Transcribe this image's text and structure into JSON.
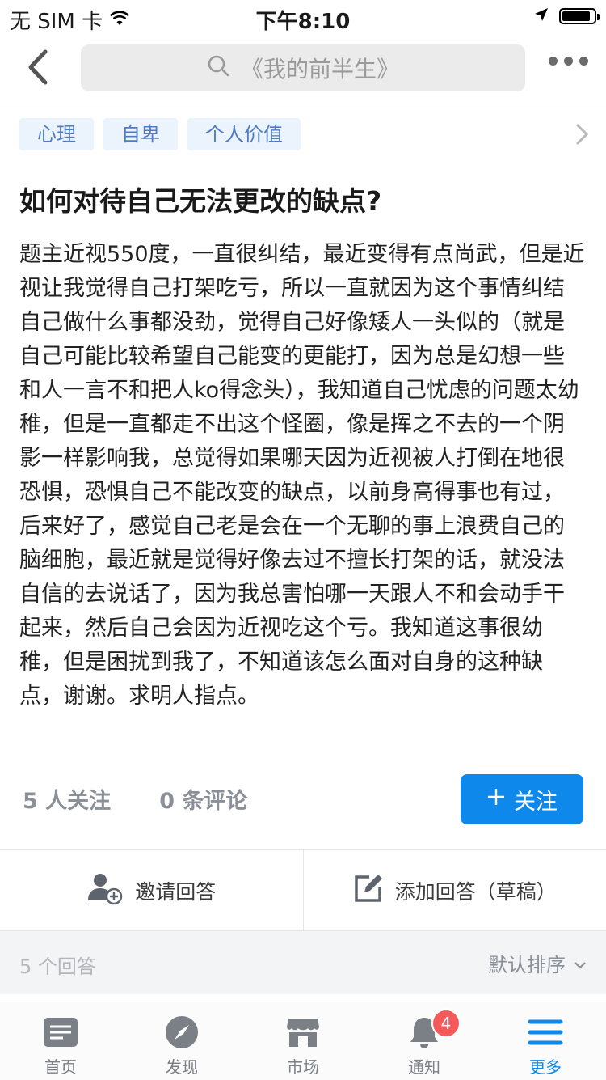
{
  "status_bar": {
    "carrier": "无 SIM 卡",
    "time": "下午8:10"
  },
  "nav": {
    "search_text": "《我的前半生》"
  },
  "tags": [
    "心理",
    "自卑",
    "个人价值"
  ],
  "question": {
    "title": "如何对待自己无法更改的缺点?",
    "body": "题主近视550度，一直很纠结，最近变得有点尚武，但是近视让我觉得自己打架吃亏，所以一直就因为这个事情纠结自己做什么事都没劲，觉得自己好像矮人一头似的（就是自己可能比较希望自己能变的更能打，因为总是幻想一些和人一言不和把人ko得念头），我知道自己忧虑的问题太幼稚，但是一直都走不出这个怪圈，像是挥之不去的一个阴影一样影响我，总觉得如果哪天因为近视被人打倒在地很恐惧，恐惧自己不能改变的缺点，以前身高得事也有过，后来好了，感觉自己老是会在一个无聊的事上浪费自己的脑细胞，最近就是觉得好像去过不擅长打架的话，就没法自信的去说话了，因为我总害怕哪一天跟人不和会动手干起来，然后自己会因为近视吃这个亏。我知道这事很幼稚，但是困扰到我了，不知道该怎么面对自身的这种缺点，谢谢。求明人指点。"
  },
  "stats": {
    "followers": "5 人关注",
    "comments": "0 条评论",
    "follow_label": "关注"
  },
  "actions": {
    "invite": "邀请回答",
    "add_answer": "添加回答（草稿）"
  },
  "answers_bar": {
    "count": "5 个回答",
    "sort": "默认排序"
  },
  "tabbar": {
    "items": [
      {
        "label": "首页",
        "icon": "home-icon"
      },
      {
        "label": "发现",
        "icon": "compass-icon"
      },
      {
        "label": "市场",
        "icon": "store-icon"
      },
      {
        "label": "通知",
        "icon": "bell-icon",
        "badge": "4"
      },
      {
        "label": "更多",
        "icon": "menu-icon",
        "active": true
      }
    ]
  },
  "colors": {
    "accent": "#0f88eb",
    "tag_bg": "#ebf3fd",
    "tag_text": "#4f7bc2",
    "badge": "#f45a5a"
  }
}
